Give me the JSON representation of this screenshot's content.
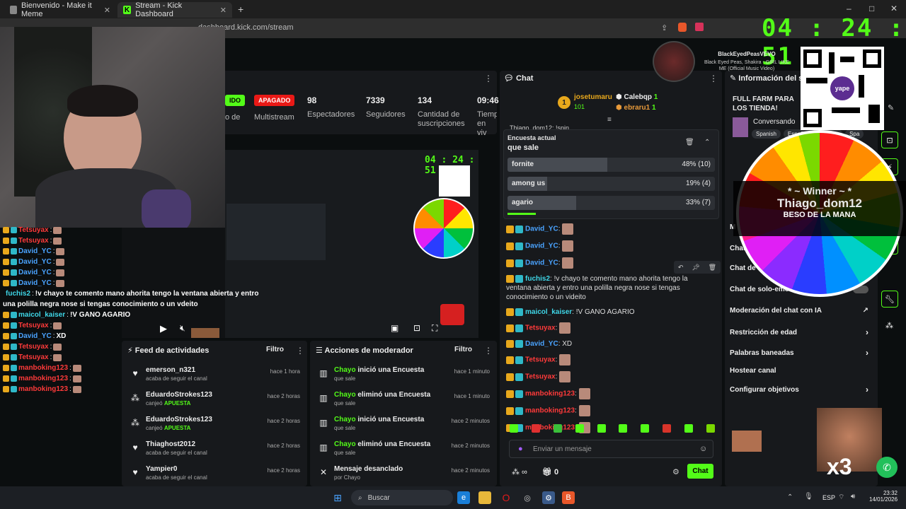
{
  "browser": {
    "tabs": [
      {
        "label": "Bienvenido - Make it Meme",
        "active": false
      },
      {
        "label": "Stream - Kick Dashboard",
        "active": true
      }
    ],
    "url": "dashboard.kick.com/stream"
  },
  "overlay": {
    "timer": "04 : 24 : 51",
    "qr_label": "yape",
    "winner_title": "* ~ Winner ~ *",
    "winner_name": "Thiago_dom12",
    "winner_prize": "BESO DE LA MANA",
    "x3": "x3",
    "now_playing_artist": "BlackEyedPeasVEVO",
    "now_playing_title": "Black Eyed Peas, Shakira - GIRL LIKE ME (Official Music Video)"
  },
  "stream_stats": {
    "live_badge": "IDO",
    "off_badge": "APAGADO",
    "multistream_label": "Multistream",
    "spectators": {
      "value": "98",
      "label": "Espectadores"
    },
    "followers": {
      "value": "7339",
      "label": "Seguidores"
    },
    "subs": {
      "value": "134",
      "label": "Cantidad de suscripciones"
    },
    "time": {
      "value": "09:46",
      "label": "Tiemp en viv"
    },
    "cut_label": "o de"
  },
  "left_chat": [
    {
      "name": "Tetsuyax",
      "color": "#ff3a3a",
      "text": ""
    },
    {
      "name": "Tetsuyax",
      "color": "#ff3a3a",
      "text": ""
    },
    {
      "name": "David_YC",
      "color": "#4aa3ff",
      "text": ""
    },
    {
      "name": "David_YC",
      "color": "#4aa3ff",
      "text": ""
    },
    {
      "name": "David_YC",
      "color": "#4aa3ff",
      "text": ""
    },
    {
      "name": "David_YC",
      "color": "#4aa3ff",
      "text": ""
    },
    {
      "name": "fuchis2",
      "color": "#3fd7e8",
      "text": "!v chayo te comento mano ahorita tengo la ventana abierta y entro"
    },
    {
      "name": "",
      "color": "#ffffff",
      "text": "una polilla negra nose si tengas conocimiento o un vdeito"
    },
    {
      "name": "maicol_kaiser",
      "color": "#3fd7e8",
      "text": "!V GANO AGARIO"
    },
    {
      "name": "Tetsuyax",
      "color": "#ff3a3a",
      "text": ""
    },
    {
      "name": "David_YC",
      "color": "#4aa3ff",
      "text": "XD"
    },
    {
      "name": "Tetsuyax",
      "color": "#ff3a3a",
      "text": ""
    },
    {
      "name": "Tetsuyax",
      "color": "#ff3a3a",
      "text": ""
    },
    {
      "name": "manboking123",
      "color": "#ff3a3a",
      "text": ""
    },
    {
      "name": "manboking123",
      "color": "#ff3a3a",
      "text": ""
    },
    {
      "name": "manboking123",
      "color": "#ff3a3a",
      "text": ""
    }
  ],
  "chat": {
    "title": "Chat",
    "leader_1": {
      "rank": "1",
      "name": "josetumaru",
      "points": "101"
    },
    "leader_2": {
      "name": "Calebqp",
      "count": "1"
    },
    "leader_3": {
      "name": "ebraru1",
      "count": "1"
    },
    "cut_line": "Thiago_dom12: !spin",
    "poll": {
      "header": "Encuesta actual",
      "question": "que sale",
      "options": [
        {
          "label": "fornite",
          "result": "48% (10)",
          "fraction": 0.48
        },
        {
          "label": "among us",
          "result": "19% (4)",
          "fraction": 0.19
        },
        {
          "label": "agario",
          "result": "33% (7)",
          "fraction": 0.33
        }
      ]
    },
    "messages": [
      {
        "name": "David_YC",
        "color": "#4aa3ff",
        "text": ""
      },
      {
        "name": "David_YC",
        "color": "#4aa3ff",
        "text": ""
      },
      {
        "name": "David_YC",
        "color": "#4aa3ff",
        "text": ""
      },
      {
        "name": "fuchis2",
        "color": "#3fd7e8",
        "text": "!v chayo te comento mano ahorita tengo la ventana abierta y entro una polilla negra nose si tengas conocimiento o un videito"
      },
      {
        "name": "maicol_kaiser",
        "color": "#3fd7e8",
        "text": "!V GANO AGARIO"
      },
      {
        "name": "Tetsuyax",
        "color": "#ff3a3a",
        "text": ""
      },
      {
        "name": "David_YC",
        "color": "#4aa3ff",
        "text": "XD"
      },
      {
        "name": "Tetsuyax",
        "color": "#ff3a3a",
        "text": ""
      },
      {
        "name": "Tetsuyax",
        "color": "#ff3a3a",
        "text": ""
      },
      {
        "name": "manboking123",
        "color": "#ff3a3a",
        "text": ""
      },
      {
        "name": "manboking123",
        "color": "#ff3a3a",
        "text": ""
      },
      {
        "name": "manboking123",
        "color": "#ff3a3a",
        "text": ""
      }
    ],
    "input_placeholder": "Enviar un mensaje",
    "points": "0",
    "send_label": "Chat"
  },
  "info": {
    "title": "Información del str",
    "stream_title": "FULL FARM PARA LOS TIENDA!",
    "category": "Conversando",
    "tags": [
      "Spanish",
      "Español",
      "Chatter",
      "Spa"
    ]
  },
  "settings": [
    {
      "label": "M"
    },
    {
      "label": "Chat"
    },
    {
      "label": "Chat de"
    },
    {
      "label": "Chat de solo-emo"
    },
    {
      "label": "Moderación del chat con IA"
    },
    {
      "label": "Restricción de edad"
    },
    {
      "label": "Palabras baneadas"
    },
    {
      "label": "Hostear canal"
    },
    {
      "label": "Configurar objetivos"
    }
  ],
  "activity_feed": {
    "title": "Feed de actividades",
    "filter": "Filtro",
    "items": [
      {
        "icon": "heart-icon",
        "glyph": "♥",
        "title": "emerson_n321",
        "sub": "acaba de seguir el canal",
        "accent": "",
        "time": "hace 1 hora"
      },
      {
        "icon": "points-icon",
        "glyph": "⁂",
        "title": "EduardoStrokes123",
        "sub": "canjeó",
        "accent": "APUESTA",
        "time": "hace 2 horas"
      },
      {
        "icon": "points-icon",
        "glyph": "⁂",
        "title": "EduardoStrokes123",
        "sub": "canjeó",
        "accent": "APUESTA",
        "time": "hace 2 horas"
      },
      {
        "icon": "heart-icon",
        "glyph": "♥",
        "title": "Thiaghost2012",
        "sub": "acaba de seguir el canal",
        "accent": "",
        "time": "hace 2 horas"
      },
      {
        "icon": "heart-icon",
        "glyph": "♥",
        "title": "Yampier0",
        "sub": "acaba de seguir el canal",
        "accent": "",
        "time": "hace 2 horas"
      }
    ]
  },
  "mod_actions": {
    "title": "Acciones de moderador",
    "filter": "Filtro",
    "items": [
      {
        "icon": "poll-icon",
        "glyph": "▥",
        "actor": "Chayo",
        "action": "inició una Encuesta",
        "sub": "que sale",
        "time": "hace 1 minuto"
      },
      {
        "icon": "poll-icon",
        "glyph": "▥",
        "actor": "Chayo",
        "action": "eliminó una Encuesta",
        "sub": "que sale",
        "time": "hace 1 minuto"
      },
      {
        "icon": "poll-icon",
        "glyph": "▥",
        "actor": "Chayo",
        "action": "inició una Encuesta",
        "sub": "que sale",
        "time": "hace 2 minutos"
      },
      {
        "icon": "poll-icon",
        "glyph": "▥",
        "actor": "Chayo",
        "action": "eliminó una Encuesta",
        "sub": "que sale",
        "time": "hace 2 minutos"
      },
      {
        "icon": "unpin-icon",
        "glyph": "✕",
        "actor": "",
        "action": "Mensaje desanclado",
        "sub": "por Chayo",
        "time": "hace 2 minutos"
      }
    ]
  },
  "taskbar": {
    "search_placeholder": "Buscar",
    "lang": "ESP",
    "time": "23:32",
    "date": "14/01/2026"
  }
}
